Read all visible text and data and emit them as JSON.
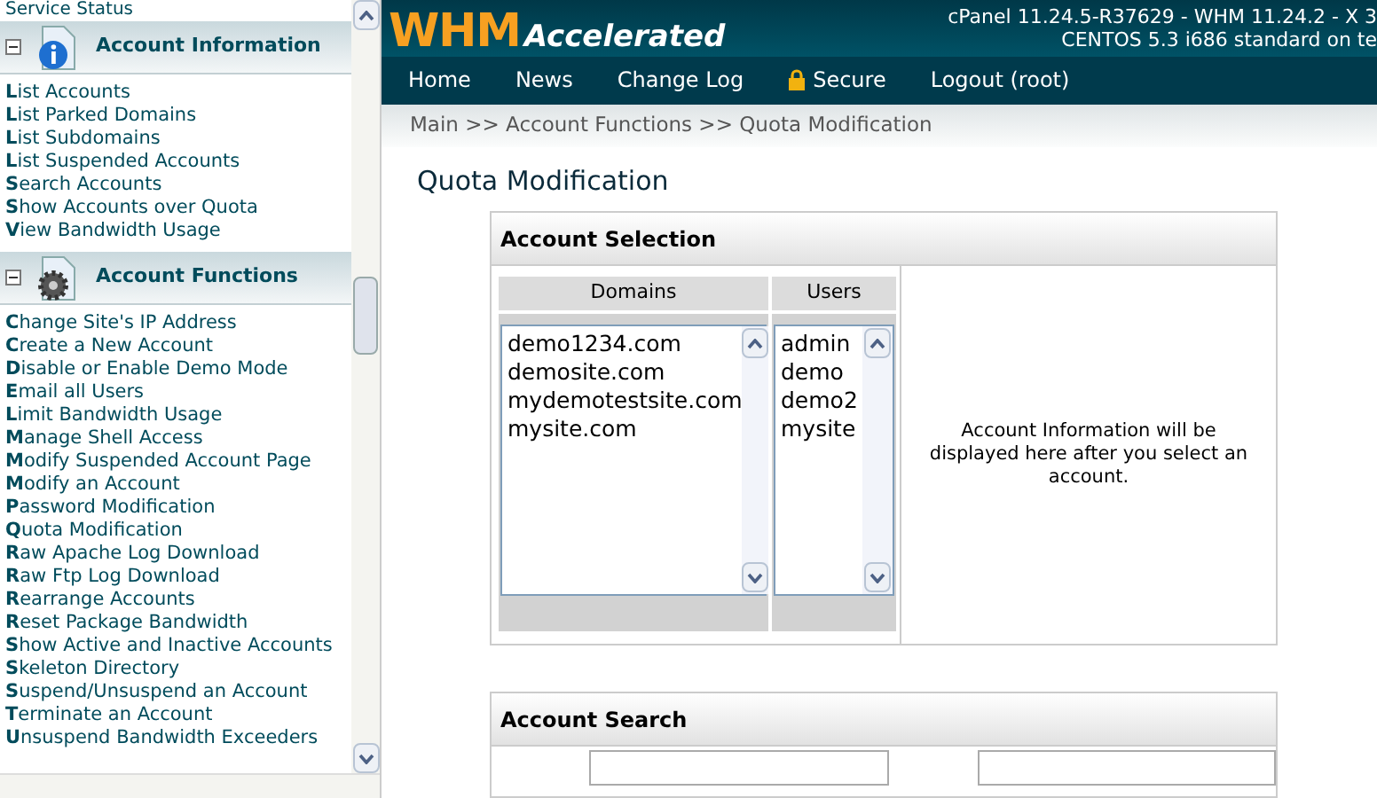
{
  "sidebar": {
    "top_item": "Service Status",
    "sections": [
      {
        "title": "Account Information",
        "kind": "info",
        "expanded": true,
        "items": [
          "**L**ist Accounts",
          "**L**ist Parked Domains",
          "**L**ist Subdomains",
          "**L**ist Suspended Accounts",
          "**S**earch Accounts",
          "**S**how Accounts over Quota",
          "**V**iew Bandwidth Usage"
        ]
      },
      {
        "title": "Account Functions",
        "kind": "gear",
        "expanded": true,
        "items": [
          "**C**hange Site's IP Address",
          "**C**reate a New Account",
          "**D**isable or Enable Demo Mode",
          "**E**mail all Users",
          "**L**imit Bandwidth Usage",
          "**M**anage Shell Access",
          "**M**odify Suspended Account Page",
          "**M**odify an Account",
          "**P**assword Modification",
          "**Q**uota Modification",
          "**R**aw Apache Log Download",
          "**R**aw Ftp Log Download",
          "**R**earrange Accounts",
          "**R**eset Package Bandwidth",
          "**S**how Active and Inactive Accounts",
          "**S**keleton Directory",
          "**S**uspend/Unsuspend an Account",
          "**T**erminate an Account",
          "**U**nsuspend Bandwidth Exceeders"
        ]
      }
    ]
  },
  "header": {
    "logo_main": "WHM",
    "logo_sub": "Accelerated",
    "version_line": "cPanel 11.24.5-R37629 - WHM 11.24.2 - X 3",
    "server_line": "CENTOS 5.3 i686 standard on te"
  },
  "nav": [
    {
      "label": "Home",
      "kind": "link"
    },
    {
      "label": "News",
      "kind": "link"
    },
    {
      "label": "Change Log",
      "kind": "link"
    },
    {
      "label": "Secure",
      "kind": "lock"
    },
    {
      "label": "Logout (root)",
      "kind": "link"
    }
  ],
  "breadcrumb": "Main >> Account Functions >> Quota Modification",
  "page_title": "Quota Modification",
  "account_selection": {
    "title": "Account Selection",
    "domains_heading": "Domains",
    "users_heading": "Users",
    "domains": [
      "demo1234.com",
      "demosite.com",
      "mydemotestsite.com",
      "mysite.com"
    ],
    "users": [
      "admin",
      "demo",
      "demo2",
      "mysite"
    ],
    "info_text": "Account Information will be displayed here after you select an account."
  },
  "account_search": {
    "title": "Account Search"
  }
}
